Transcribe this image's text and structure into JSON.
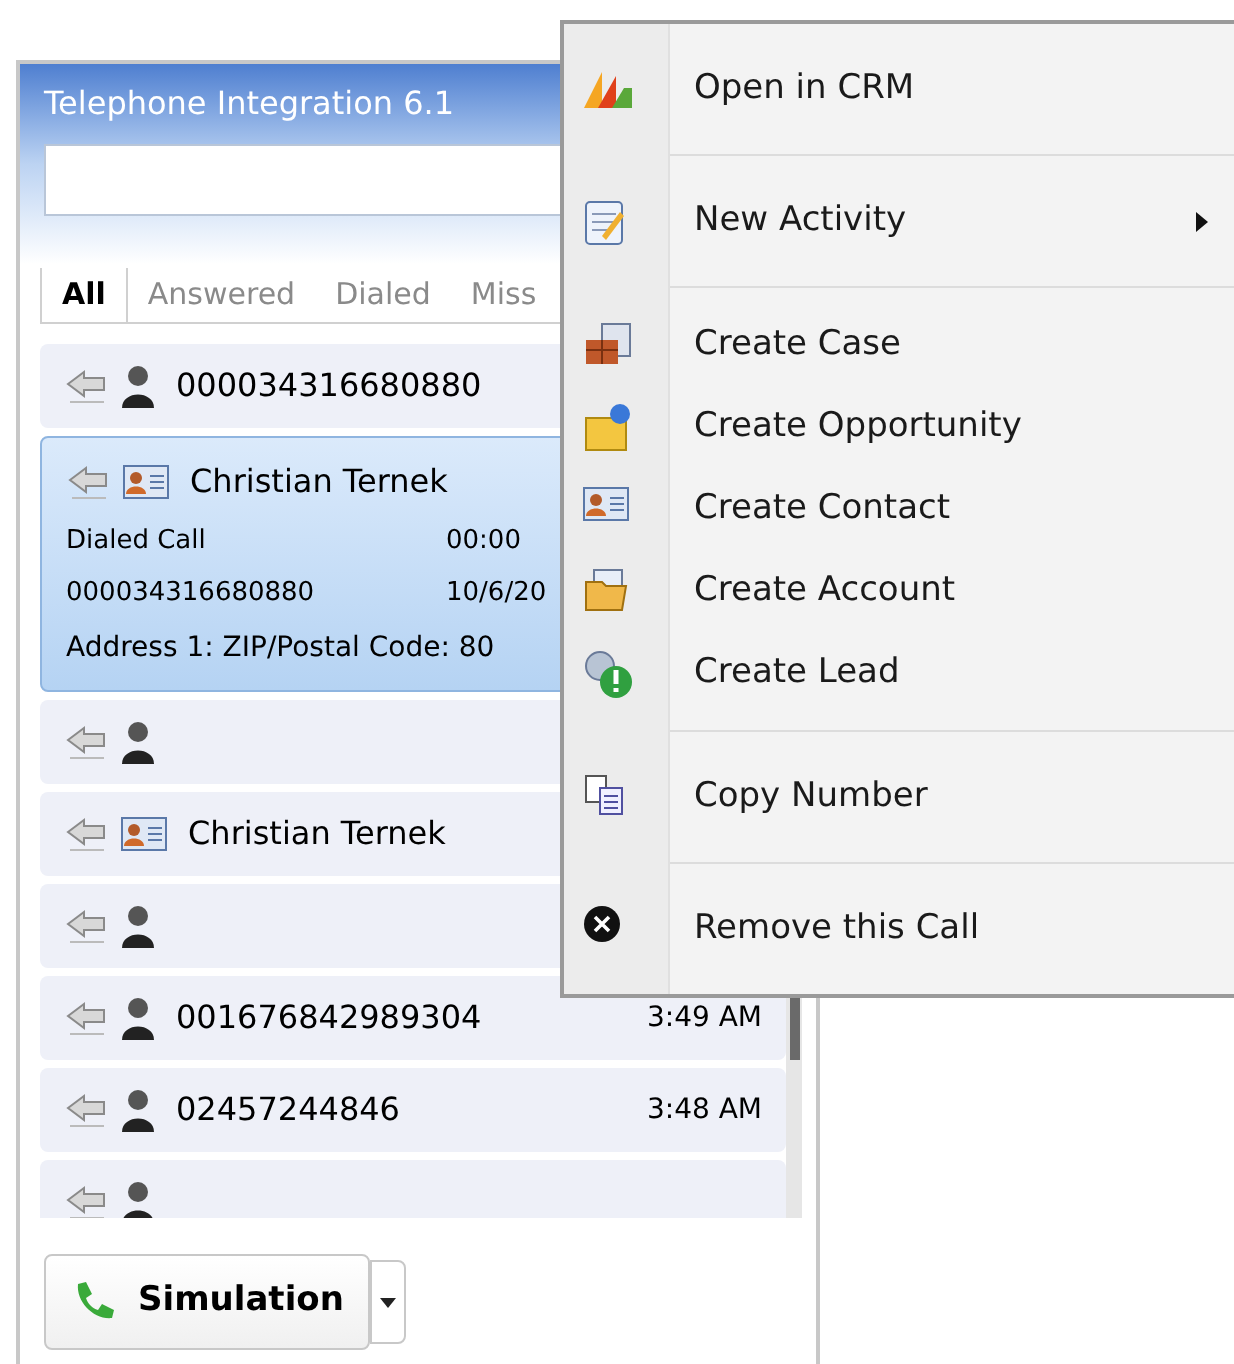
{
  "window": {
    "title": "Telephone Integration 6.1"
  },
  "tabs": [
    {
      "label": "All",
      "selected": true
    },
    {
      "label": "Answered",
      "selected": false
    },
    {
      "label": "Dialed",
      "selected": false
    },
    {
      "label": "Miss",
      "selected": false
    }
  ],
  "calls": [
    {
      "kind": "unknown",
      "name": "000034316680880",
      "selected": false
    },
    {
      "kind": "contact",
      "name": "Christian Ternek",
      "selected": true,
      "details": {
        "type": "Dialed Call",
        "duration": "00:00",
        "number": "000034316680880",
        "date": "10/6/20",
        "address": "Address 1: ZIP/Postal Code: 80"
      }
    },
    {
      "kind": "unknown",
      "selected": false
    },
    {
      "kind": "contact",
      "name": "Christian Ternek",
      "selected": false
    },
    {
      "kind": "unknown",
      "selected": false
    },
    {
      "kind": "unknown",
      "name": "001676842989304",
      "time": "3:49 AM",
      "selected": false
    },
    {
      "kind": "unknown",
      "name": "02457244846",
      "time": "3:48 AM",
      "selected": false
    },
    {
      "kind": "unknown",
      "selected": false
    }
  ],
  "simulation_button": {
    "label": "Simulation"
  },
  "context_menu": {
    "groups": [
      [
        {
          "kind": "crm",
          "label": "Open in CRM"
        }
      ],
      [
        {
          "kind": "activity",
          "label": "New Activity",
          "submenu": true
        }
      ],
      [
        {
          "kind": "case",
          "label": "Create Case"
        },
        {
          "kind": "opportunity",
          "label": "Create Opportunity"
        },
        {
          "kind": "contact",
          "label": "Create Contact"
        },
        {
          "kind": "account",
          "label": "Create Account"
        },
        {
          "kind": "lead",
          "label": "Create Lead"
        }
      ],
      [
        {
          "kind": "copy",
          "label": "Copy Number"
        }
      ],
      [
        {
          "kind": "remove",
          "label": "Remove this Call"
        }
      ]
    ]
  }
}
